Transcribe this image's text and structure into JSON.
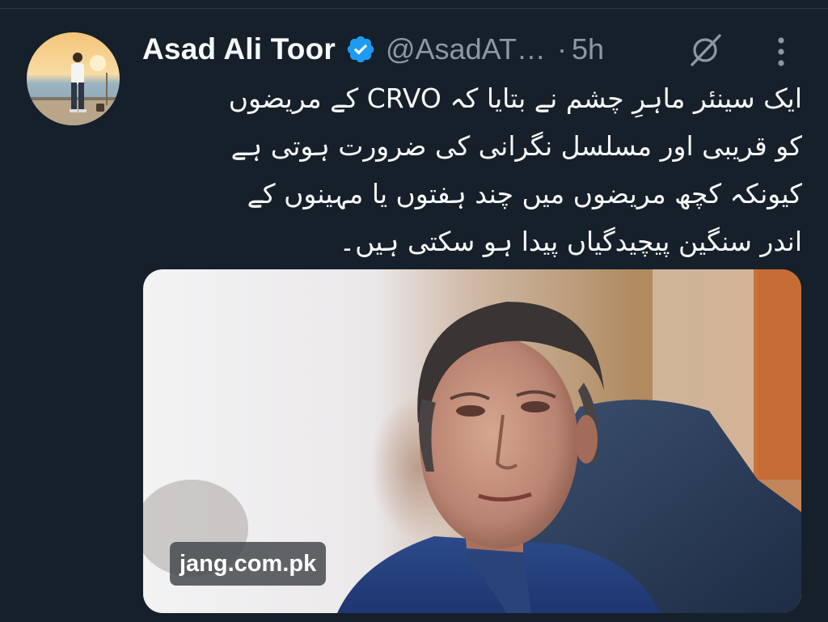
{
  "tweet": {
    "author": {
      "display_name": "Asad Ali Toor",
      "handle": "@AsadAT…",
      "verified": true,
      "avatar_icon": "profile-photo"
    },
    "separator": "·",
    "timestamp": "5h",
    "grok_icon": "grok-icon",
    "more_icon": "more-vertical-icon",
    "text_lines": [
      "ایک سینئر ماہرِ چشم نے بتایا کہ CRVO کے مریضوں",
      "کو قریبی اور مسلسل نگرانی کی ضرورت ہوتی ہے",
      "کیونکہ کچھ مریضوں میں چند ہفتوں یا مہینوں کے",
      "اندر سنگین پیچیدگیاں پیدا ہو سکتی ہیں۔"
    ],
    "media": {
      "source_label": "jang.com.pk"
    }
  },
  "colors": {
    "background": "#15202b",
    "text_primary": "#f7f9f9",
    "text_secondary": "#8b98a5",
    "verified_blue": "#1d9bf0"
  }
}
